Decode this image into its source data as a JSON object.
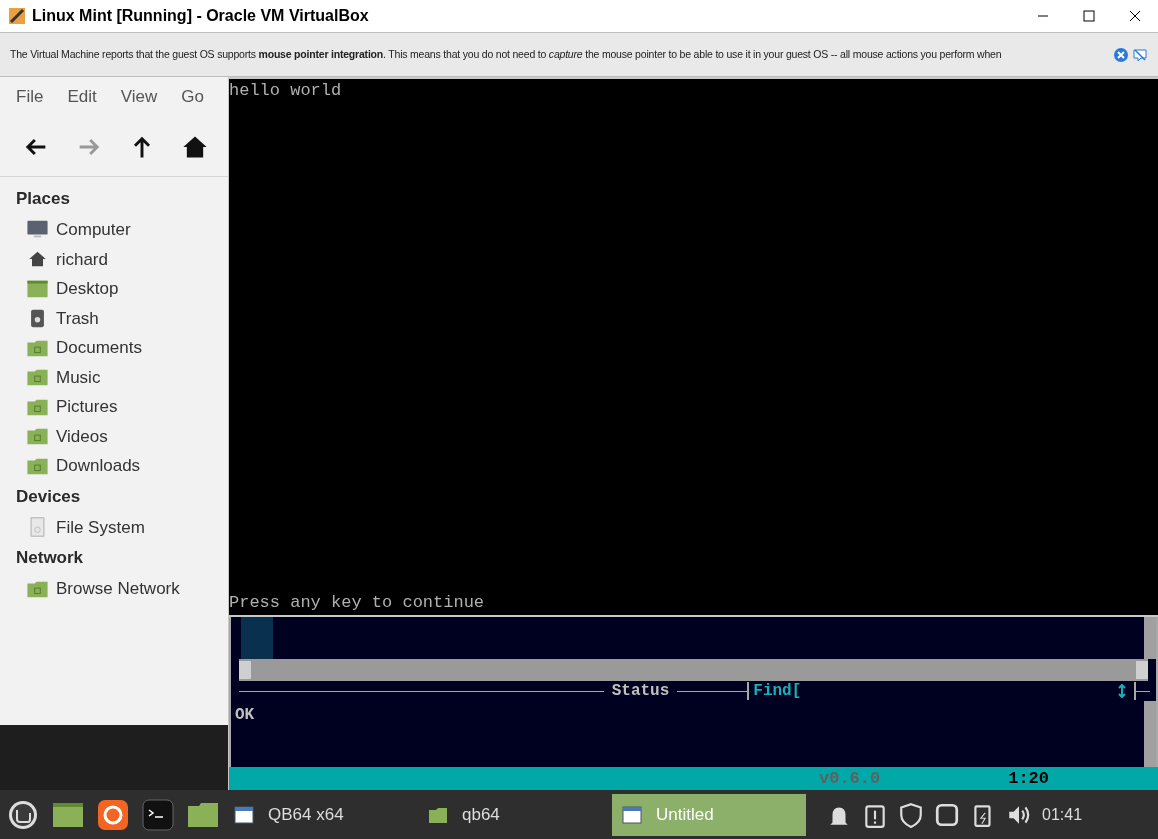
{
  "window": {
    "title": "Linux Mint [Running] - Oracle VM VirtualBox"
  },
  "notification": {
    "text": "The Virtual Machine reports that the guest OS supports **mouse pointer integration**. This means that you do not need to *capture* the mouse pointer to be able to use it in your guest OS -- all mouse actions you perform when"
  },
  "file_manager": {
    "menu": [
      "File",
      "Edit",
      "View",
      "Go"
    ],
    "toolbar": [
      {
        "kind": "back",
        "disabled": false
      },
      {
        "kind": "forward",
        "disabled": true
      },
      {
        "kind": "up",
        "disabled": false
      },
      {
        "kind": "home",
        "disabled": false
      }
    ],
    "sidebar": [
      {
        "heading": "Places",
        "items": [
          {
            "label": "Computer",
            "kind": "monitor"
          },
          {
            "label": "richard",
            "kind": "home"
          },
          {
            "label": "Desktop",
            "kind": "desktop"
          },
          {
            "label": "Trash",
            "kind": "trash"
          },
          {
            "label": "Documents",
            "kind": "folder"
          },
          {
            "label": "Music",
            "kind": "folder"
          },
          {
            "label": "Pictures",
            "kind": "folder"
          },
          {
            "label": "Videos",
            "kind": "folder"
          },
          {
            "label": "Downloads",
            "kind": "folder"
          }
        ]
      },
      {
        "heading": "Devices",
        "items": [
          {
            "label": "File System",
            "kind": "drive"
          }
        ]
      },
      {
        "heading": "Network",
        "items": [
          {
            "label": "Browse Network",
            "kind": "folder"
          }
        ]
      }
    ]
  },
  "qb64": {
    "output_lines": [
      "hello world",
      "Press any key to continue"
    ],
    "status_title": "Status",
    "find_label": "Find[",
    "status_message": "OK",
    "version": "v0.6.0",
    "position": "1:20"
  },
  "taskbar": {
    "launchers": [
      {
        "kind": "menu"
      },
      {
        "kind": "desktop"
      },
      {
        "kind": "firefox"
      },
      {
        "kind": "terminal"
      },
      {
        "kind": "folder"
      }
    ],
    "windows": [
      {
        "label": "QB64 x64",
        "kind": "window",
        "selected": false
      },
      {
        "label": "qb64",
        "kind": "folder",
        "selected": false
      },
      {
        "label": "Untitled",
        "kind": "window",
        "selected": true
      }
    ],
    "tray": [
      {
        "kind": "bell"
      },
      {
        "kind": "clipboard"
      },
      {
        "kind": "shield"
      },
      {
        "kind": "display"
      },
      {
        "kind": "battery"
      },
      {
        "kind": "volume"
      }
    ],
    "clock": "01:41"
  }
}
